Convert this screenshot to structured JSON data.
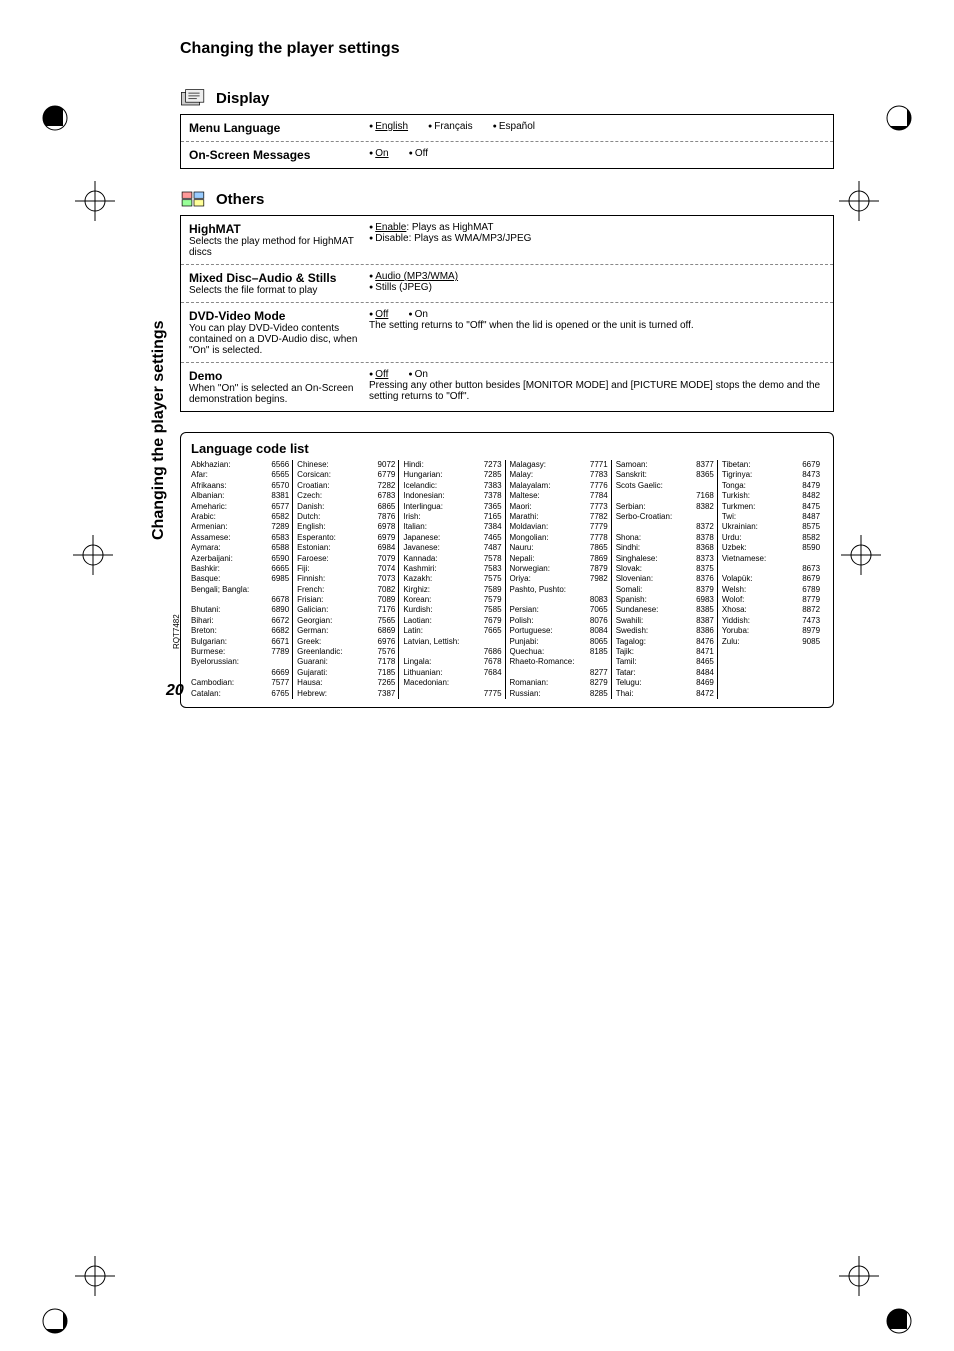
{
  "page_number": "20",
  "page_code": "RQT7482",
  "title": "Changing the player settings",
  "sidebar_label": "Changing the player settings",
  "sections": {
    "display": {
      "title": "Display",
      "rows": [
        {
          "name": "Menu Language",
          "desc": "",
          "opts": [
            {
              "label": "English",
              "u": true
            },
            {
              "label": "Français",
              "u": false
            },
            {
              "label": "Español",
              "u": false
            }
          ]
        },
        {
          "name": "On-Screen Messages",
          "desc": "",
          "opts": [
            {
              "label": "On",
              "u": true
            },
            {
              "label": "Off",
              "u": false
            }
          ]
        }
      ]
    },
    "others": {
      "title": "Others",
      "rows": [
        {
          "name": "HighMAT",
          "desc": "Selects the play method for HighMAT discs",
          "opts": [
            {
              "label": "Enable",
              "u": true,
              "suffix": ": Plays as HighMAT"
            },
            {
              "label": "Disable: Plays as WMA/MP3/JPEG",
              "u": false,
              "block": true
            }
          ]
        },
        {
          "name": "Mixed Disc–Audio & Stills",
          "desc": "Selects the file format to play",
          "opts": [
            {
              "label": "Audio (MP3/WMA)",
              "u": true,
              "block": true
            },
            {
              "label": "Stills (JPEG)",
              "u": false,
              "block": true
            }
          ]
        },
        {
          "name": "DVD-Video Mode",
          "desc": "You can play DVD-Video contents contained on a DVD-Audio disc, when \"On\" is selected.",
          "opts": [
            {
              "label": "Off",
              "u": true
            },
            {
              "label": "On",
              "u": false
            }
          ],
          "extra": "The setting returns to \"Off\" when the lid is opened or the unit is turned off."
        },
        {
          "name": "Demo",
          "desc": "When \"On\" is selected an On-Screen demonstration begins.",
          "opts": [
            {
              "label": "Off",
              "u": true
            },
            {
              "label": "On",
              "u": false
            }
          ],
          "extra": "Pressing any other button besides [MONITOR MODE] and [PICTURE MODE] stops the demo and the setting returns to \"Off\"."
        }
      ]
    }
  },
  "lang_title": "Language code list",
  "lang_cols": [
    [
      {
        "n": "Abkhazian:",
        "c": "6566"
      },
      {
        "n": "Afar:",
        "c": "6565"
      },
      {
        "n": "Afrikaans:",
        "c": "6570"
      },
      {
        "n": "Albanian:",
        "c": "8381"
      },
      {
        "n": "Ameharic:",
        "c": "6577"
      },
      {
        "n": "Arabic:",
        "c": "6582"
      },
      {
        "n": "Armenian:",
        "c": "7289"
      },
      {
        "n": "Assamese:",
        "c": "6583"
      },
      {
        "n": "Aymara:",
        "c": "6588"
      },
      {
        "n": "Azerbaijani:",
        "c": "6590"
      },
      {
        "n": "Bashkir:",
        "c": "6665"
      },
      {
        "n": "Basque:",
        "c": "6985"
      },
      {
        "n": "Bengali; Bangla:",
        "c": ""
      },
      {
        "n": "",
        "c": "6678"
      },
      {
        "n": "Bhutani:",
        "c": "6890"
      },
      {
        "n": "Bihari:",
        "c": "6672"
      },
      {
        "n": "Breton:",
        "c": "6682"
      },
      {
        "n": "Bulgarian:",
        "c": "6671"
      },
      {
        "n": "Burmese:",
        "c": "7789"
      },
      {
        "n": "Byelorussian:",
        "c": ""
      },
      {
        "n": "",
        "c": "6669"
      },
      {
        "n": "Cambodian:",
        "c": "7577"
      },
      {
        "n": "Catalan:",
        "c": "6765"
      }
    ],
    [
      {
        "n": "Chinese:",
        "c": "9072"
      },
      {
        "n": "Corsican:",
        "c": "6779"
      },
      {
        "n": "Croatian:",
        "c": "7282"
      },
      {
        "n": "Czech:",
        "c": "6783"
      },
      {
        "n": "Danish:",
        "c": "6865"
      },
      {
        "n": "Dutch:",
        "c": "7876"
      },
      {
        "n": "English:",
        "c": "6978"
      },
      {
        "n": "Esperanto:",
        "c": "6979"
      },
      {
        "n": "Estonian:",
        "c": "6984"
      },
      {
        "n": "Faroese:",
        "c": "7079"
      },
      {
        "n": "Fiji:",
        "c": "7074"
      },
      {
        "n": "Finnish:",
        "c": "7073"
      },
      {
        "n": "French:",
        "c": "7082"
      },
      {
        "n": "Frisian:",
        "c": "7089"
      },
      {
        "n": "Galician:",
        "c": "7176"
      },
      {
        "n": "Georgian:",
        "c": "7565"
      },
      {
        "n": "German:",
        "c": "6869"
      },
      {
        "n": "Greek:",
        "c": "6976"
      },
      {
        "n": "Greenlandic:",
        "c": "7576"
      },
      {
        "n": "Guarani:",
        "c": "7178"
      },
      {
        "n": "Gujarati:",
        "c": "7185"
      },
      {
        "n": "Hausa:",
        "c": "7265"
      },
      {
        "n": "Hebrew:",
        "c": "7387"
      }
    ],
    [
      {
        "n": "Hindi:",
        "c": "7273"
      },
      {
        "n": "Hungarian:",
        "c": "7285"
      },
      {
        "n": "Icelandic:",
        "c": "7383"
      },
      {
        "n": "Indonesian:",
        "c": "7378"
      },
      {
        "n": "Interlingua:",
        "c": "7365"
      },
      {
        "n": "Irish:",
        "c": "7165"
      },
      {
        "n": "Italian:",
        "c": "7384"
      },
      {
        "n": "Japanese:",
        "c": "7465"
      },
      {
        "n": "Javanese:",
        "c": "7487"
      },
      {
        "n": "Kannada:",
        "c": "7578"
      },
      {
        "n": "Kashmiri:",
        "c": "7583"
      },
      {
        "n": "Kazakh:",
        "c": "7575"
      },
      {
        "n": "Kirghiz:",
        "c": "7589"
      },
      {
        "n": "Korean:",
        "c": "7579"
      },
      {
        "n": "Kurdish:",
        "c": "7585"
      },
      {
        "n": "Laotian:",
        "c": "7679"
      },
      {
        "n": "Latin:",
        "c": "7665"
      },
      {
        "n": "Latvian, Lettish:",
        "c": ""
      },
      {
        "n": "",
        "c": "7686"
      },
      {
        "n": "Lingala:",
        "c": "7678"
      },
      {
        "n": "Lithuanian:",
        "c": "7684"
      },
      {
        "n": "Macedonian:",
        "c": ""
      },
      {
        "n": "",
        "c": "7775"
      }
    ],
    [
      {
        "n": "Malagasy:",
        "c": "7771"
      },
      {
        "n": "Malay:",
        "c": "7783"
      },
      {
        "n": "Malayalam:",
        "c": "7776"
      },
      {
        "n": "Maltese:",
        "c": "7784"
      },
      {
        "n": "Maori:",
        "c": "7773"
      },
      {
        "n": "Marathi:",
        "c": "7782"
      },
      {
        "n": "Moldavian:",
        "c": "7779"
      },
      {
        "n": "Mongolian:",
        "c": "7778"
      },
      {
        "n": "Nauru:",
        "c": "7865"
      },
      {
        "n": "Nepali:",
        "c": "7869"
      },
      {
        "n": "Norwegian:",
        "c": "7879"
      },
      {
        "n": "Oriya:",
        "c": "7982"
      },
      {
        "n": "Pashto, Pushto:",
        "c": ""
      },
      {
        "n": "",
        "c": "8083"
      },
      {
        "n": "Persian:",
        "c": "7065"
      },
      {
        "n": "Polish:",
        "c": "8076"
      },
      {
        "n": "Portuguese:",
        "c": "8084"
      },
      {
        "n": "Punjabi:",
        "c": "8065"
      },
      {
        "n": "Quechua:",
        "c": "8185"
      },
      {
        "n": "Rhaeto-Romance:",
        "c": ""
      },
      {
        "n": "",
        "c": "8277"
      },
      {
        "n": "Romanian:",
        "c": "8279"
      },
      {
        "n": "Russian:",
        "c": "8285"
      }
    ],
    [
      {
        "n": "Samoan:",
        "c": "8377"
      },
      {
        "n": "Sanskrit:",
        "c": "8365"
      },
      {
        "n": "Scots Gaelic:",
        "c": ""
      },
      {
        "n": "",
        "c": "7168"
      },
      {
        "n": "Serbian:",
        "c": "8382"
      },
      {
        "n": "Serbo-Croatian:",
        "c": ""
      },
      {
        "n": "",
        "c": "8372"
      },
      {
        "n": "Shona:",
        "c": "8378"
      },
      {
        "n": "Sindhi:",
        "c": "8368"
      },
      {
        "n": "Singhalese:",
        "c": "8373"
      },
      {
        "n": "Slovak:",
        "c": "8375"
      },
      {
        "n": "Slovenian:",
        "c": "8376"
      },
      {
        "n": "Somali:",
        "c": "8379"
      },
      {
        "n": "Spanish:",
        "c": "6983"
      },
      {
        "n": "Sundanese:",
        "c": "8385"
      },
      {
        "n": "Swahili:",
        "c": "8387"
      },
      {
        "n": "Swedish:",
        "c": "8386"
      },
      {
        "n": "Tagalog:",
        "c": "8476"
      },
      {
        "n": "Tajik:",
        "c": "8471"
      },
      {
        "n": "Tamil:",
        "c": "8465"
      },
      {
        "n": "Tatar:",
        "c": "8484"
      },
      {
        "n": "Telugu:",
        "c": "8469"
      },
      {
        "n": "Thai:",
        "c": "8472"
      }
    ],
    [
      {
        "n": "Tibetan:",
        "c": "6679"
      },
      {
        "n": "Tigrinya:",
        "c": "8473"
      },
      {
        "n": "Tonga:",
        "c": "8479"
      },
      {
        "n": "Turkish:",
        "c": "8482"
      },
      {
        "n": "Turkmen:",
        "c": "8475"
      },
      {
        "n": "Twi:",
        "c": "8487"
      },
      {
        "n": "Ukrainian:",
        "c": "8575"
      },
      {
        "n": "Urdu:",
        "c": "8582"
      },
      {
        "n": "Uzbek:",
        "c": "8590"
      },
      {
        "n": "Vietnamese:",
        "c": ""
      },
      {
        "n": "",
        "c": "8673"
      },
      {
        "n": "Volapük:",
        "c": "8679"
      },
      {
        "n": "Welsh:",
        "c": "6789"
      },
      {
        "n": "Wolof:",
        "c": "8779"
      },
      {
        "n": "Xhosa:",
        "c": "8872"
      },
      {
        "n": "Yiddish:",
        "c": "7473"
      },
      {
        "n": "Yoruba:",
        "c": "8979"
      },
      {
        "n": "Zulu:",
        "c": "9085"
      }
    ]
  ]
}
